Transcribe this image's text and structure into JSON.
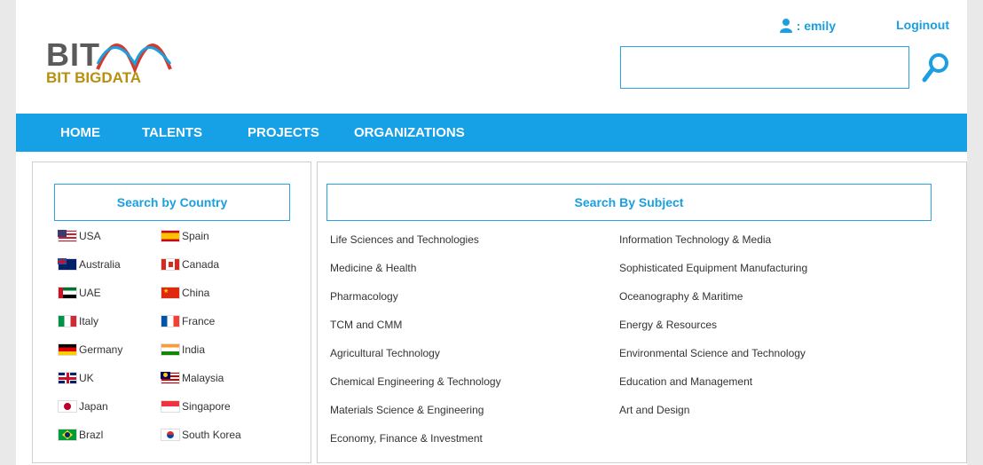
{
  "brand": {
    "logo_text": "BIT",
    "tagline": "BIT BIGDATA"
  },
  "user": {
    "label": ": emily",
    "logout": "Loginout"
  },
  "search": {
    "placeholder": ""
  },
  "nav": [
    "HOME",
    "TALENTS",
    "PROJECTS",
    "ORGANIZATIONS"
  ],
  "country_panel": {
    "title": "Search by Country",
    "countries": [
      [
        "USA",
        "Spain"
      ],
      [
        "Australia",
        "Canada"
      ],
      [
        "UAE",
        "China"
      ],
      [
        "Italy",
        "France"
      ],
      [
        "Germany",
        "India"
      ],
      [
        "UK",
        "Malaysia"
      ],
      [
        "Japan",
        "Singapore"
      ],
      [
        "Brazl",
        "South Korea"
      ]
    ]
  },
  "subject_panel": {
    "title": "Search By Subject",
    "left": [
      "Life Sciences and Technologies",
      "Medicine & Health",
      "Pharmacology",
      "TCM and CMM",
      "Agricultural Technology",
      "Chemical Engineering & Technology",
      "Materials Science & Engineering",
      "Economy, Finance & Investment"
    ],
    "right": [
      "Information Technology & Media",
      "Sophisticated Equipment Manufacturing",
      "Oceanography & Maritime",
      "Energy & Resources",
      "Environmental Science and Technology",
      "Education and Management",
      "Art and Design"
    ]
  },
  "colors": {
    "accent": "#16a0e6",
    "gold": "#b8900f",
    "grey_logo": "#5a5a5a"
  }
}
